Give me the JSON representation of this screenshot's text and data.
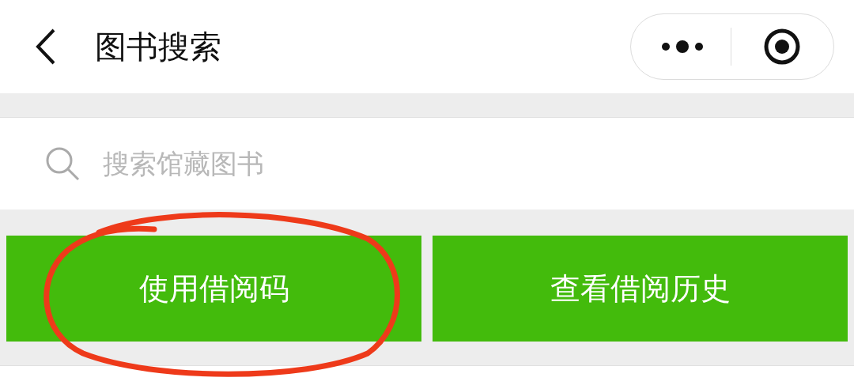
{
  "header": {
    "title": "图书搜索"
  },
  "search": {
    "placeholder": "搜索馆藏图书"
  },
  "buttons": [
    {
      "label": "使用借阅码"
    },
    {
      "label": "查看借阅历史"
    }
  ]
}
